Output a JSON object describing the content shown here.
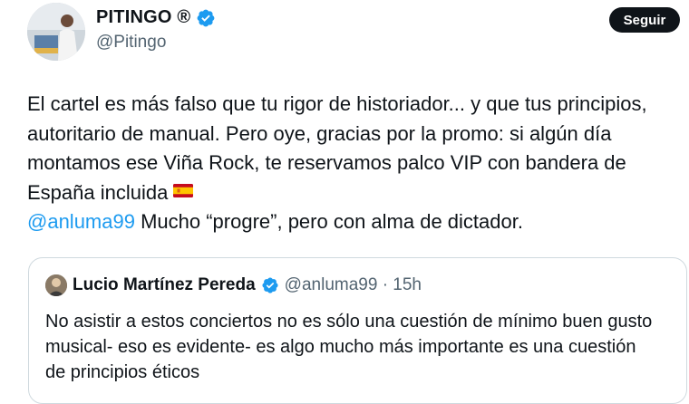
{
  "author": {
    "display_name": "PITINGO ®",
    "handle": "@Pitingo",
    "verified_color": "#1d9bf0"
  },
  "follow_button": {
    "label": "Seguir"
  },
  "tweet": {
    "lines": [
      "El cartel es más falso que tu rigor de historiador... y que tus principios,",
      "autoritario de manual. Pero oye, gracias por la promo: si algún día",
      "montamos ese Viña Rock, te reservamos palco VIP con bandera de",
      "España incluida"
    ],
    "flag_icon": "spain-flag-icon",
    "mention": "@anluma99",
    "after_mention": " Mucho “progre”, pero con alma de dictador."
  },
  "quoted_tweet": {
    "display_name": "Lucio Martínez Pereda",
    "meta": "@anluma99 · 15h",
    "lines": [
      "No asistir a estos conciertos no es sólo una cuestión de mínimo buen gusto",
      "musical- eso es evidente- es algo mucho más importante es una cuestión",
      "de principios éticos"
    ]
  },
  "colors": {
    "text": "#0f1419",
    "secondary": "#536471",
    "link": "#1d9bf0",
    "button_bg": "#0f1419",
    "border": "#cfd9de"
  }
}
